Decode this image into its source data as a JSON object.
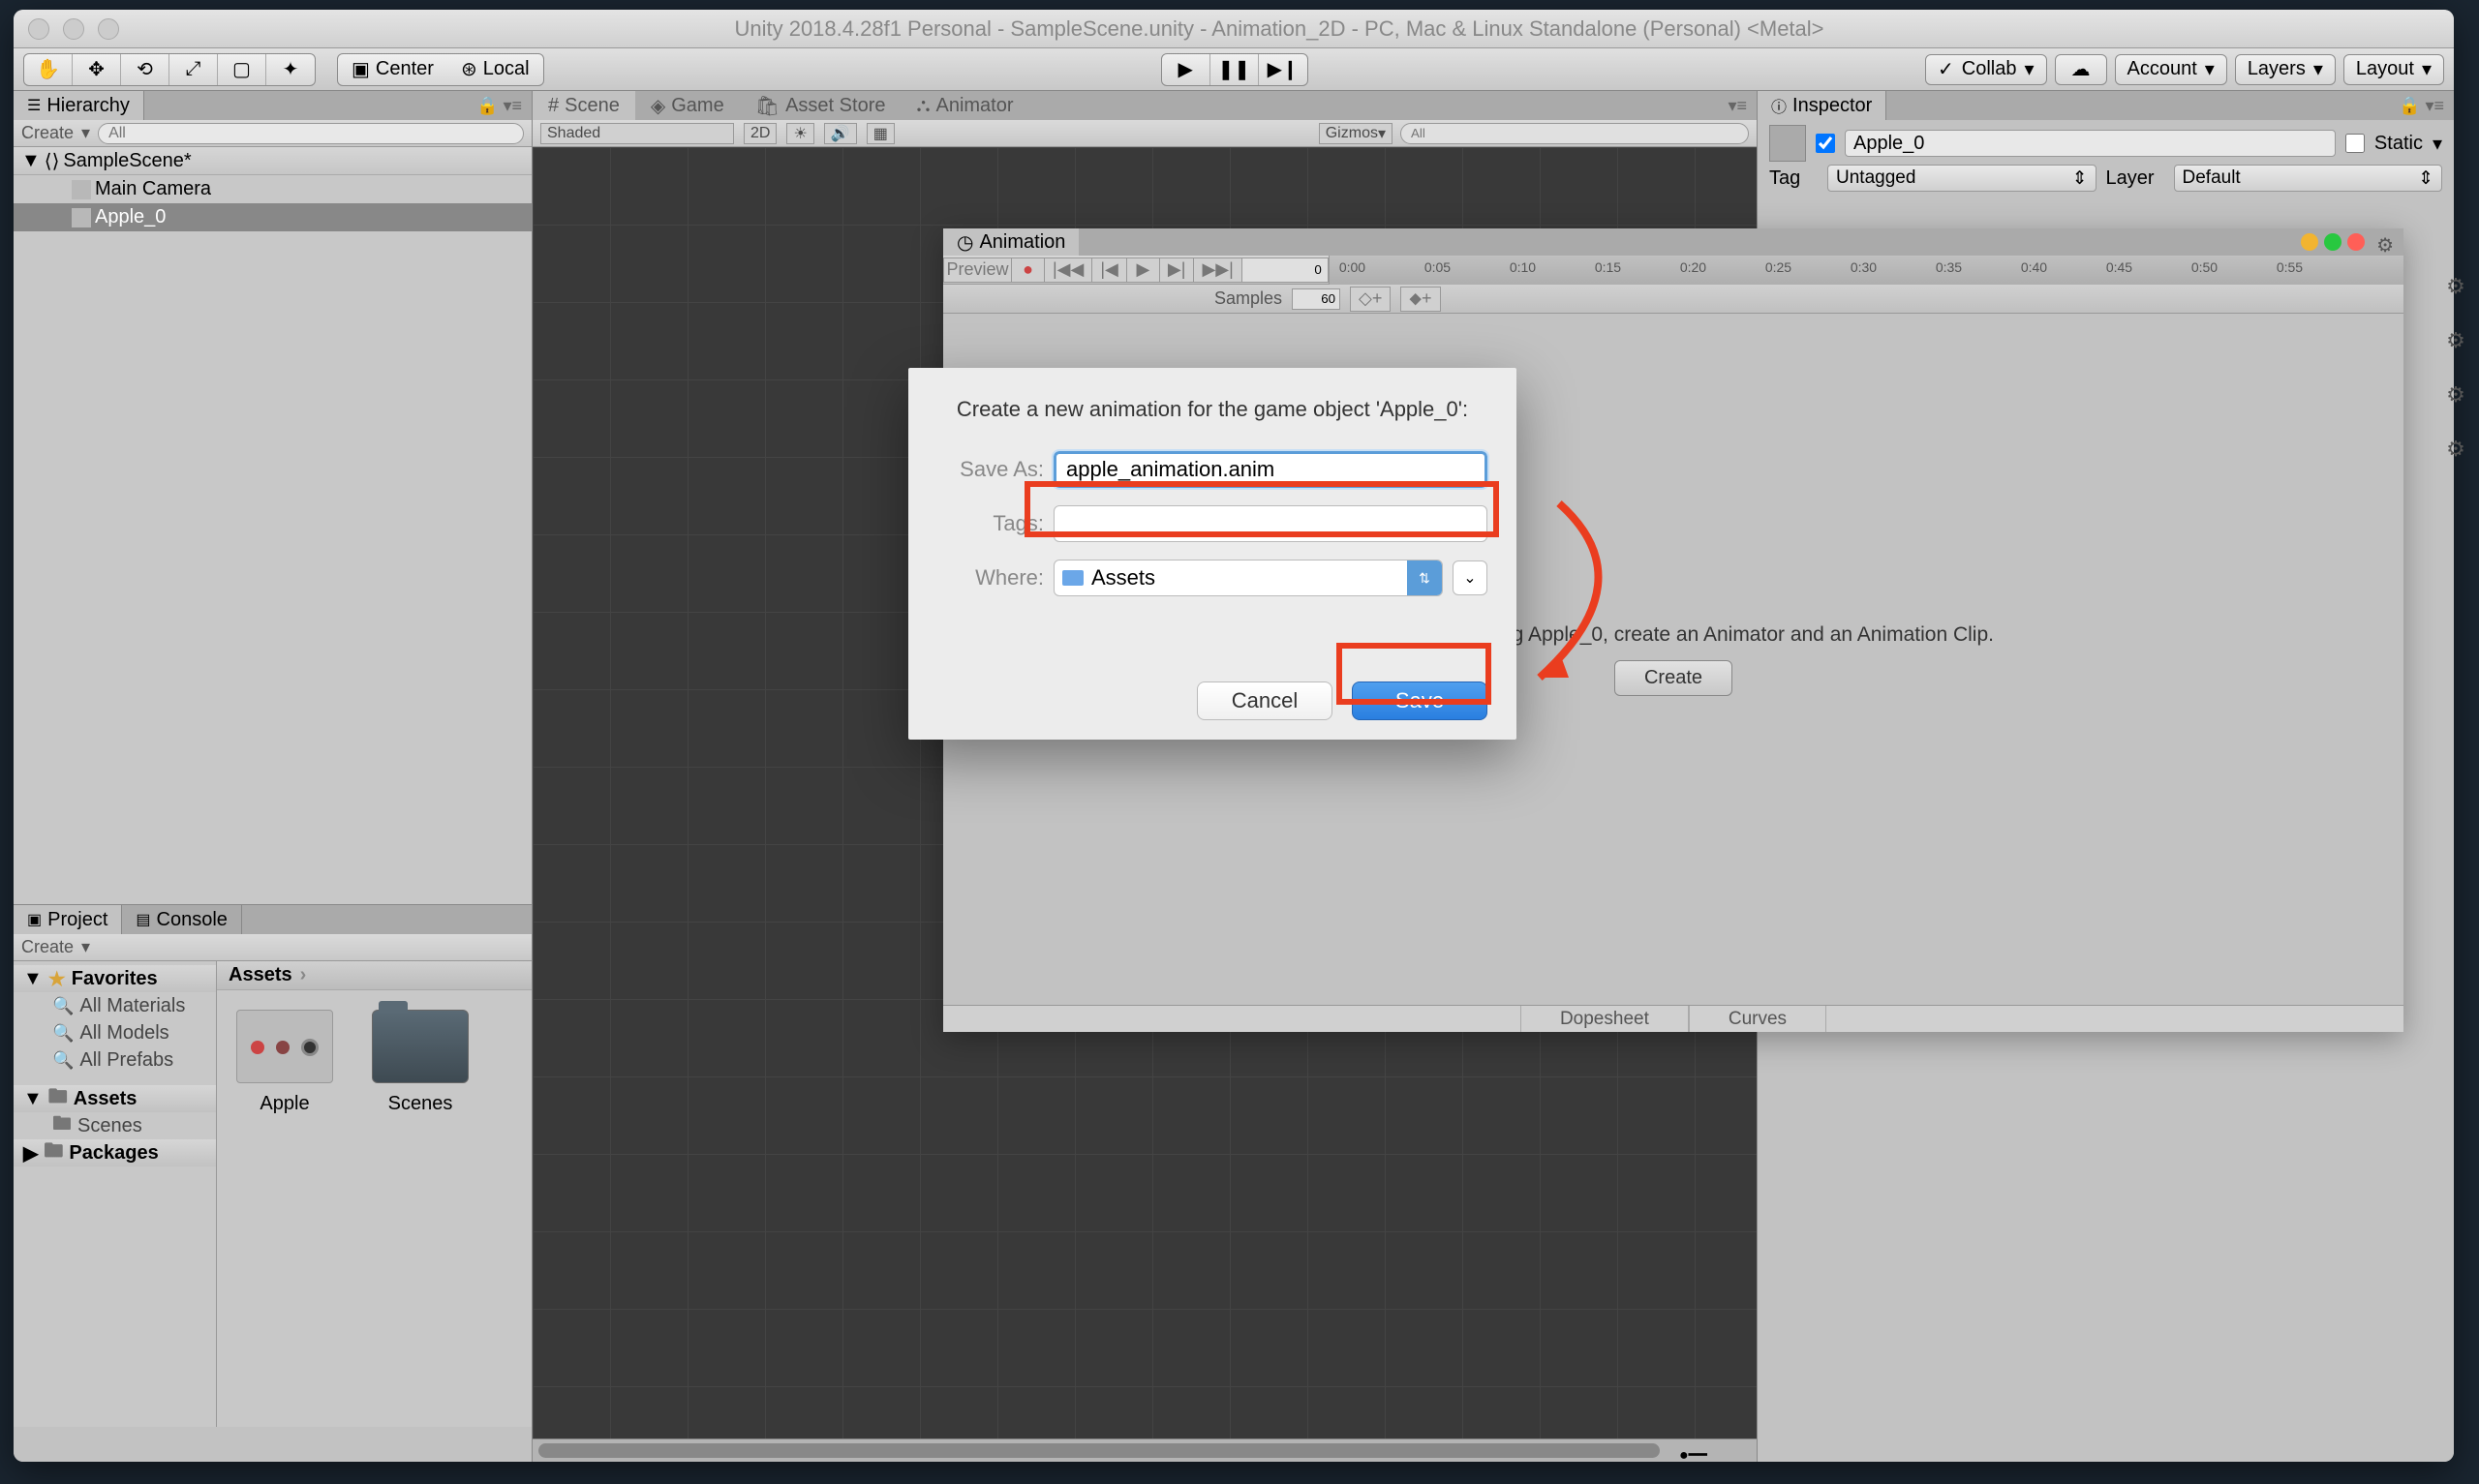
{
  "window": {
    "title": "Unity 2018.4.28f1 Personal - SampleScene.unity - Animation_2D - PC, Mac & Linux Standalone (Personal) <Metal>"
  },
  "toolbar": {
    "center_label": "Center",
    "local_label": "Local",
    "collab_label": "Collab",
    "account_label": "Account",
    "layers_label": "Layers",
    "layout_label": "Layout"
  },
  "hierarchy": {
    "tab": "Hierarchy",
    "create": "Create",
    "search_placeholder": "All",
    "root": "SampleScene*",
    "items": [
      "Main Camera",
      "Apple_0"
    ]
  },
  "scene_tabs": {
    "scene": "Scene",
    "game": "Game",
    "asset_store": "Asset Store",
    "animator": "Animator"
  },
  "scene_toolbar": {
    "shading": "Shaded",
    "mode_2d": "2D",
    "gizmos": "Gizmos",
    "search_placeholder": "All"
  },
  "inspector": {
    "tab": "Inspector",
    "object_name": "Apple_0",
    "static_label": "Static",
    "tag_label": "Tag",
    "tag_value": "Untagged",
    "layer_label": "Layer",
    "layer_value": "Default"
  },
  "project": {
    "tab_project": "Project",
    "tab_console": "Console",
    "create": "Create",
    "favorites": "Favorites",
    "fav_items": [
      "All Materials",
      "All Models",
      "All Prefabs"
    ],
    "assets": "Assets",
    "assets_children": [
      "Scenes"
    ],
    "packages": "Packages",
    "breadcrumb": "Assets",
    "grid_items": [
      "Apple",
      "Scenes"
    ]
  },
  "animation": {
    "tab": "Animation",
    "preview": "Preview",
    "frame_value": "0",
    "samples_label": "Samples",
    "samples_value": "60",
    "ruler_marks": [
      "0:00",
      "0:05",
      "0:10",
      "0:15",
      "0:20",
      "0:25",
      "0:30",
      "0:35",
      "0:40",
      "0:45",
      "0:50",
      "0:55"
    ],
    "message": "To begin animating Apple_0, create an Animator and an Animation Clip.",
    "create_btn": "Create",
    "dopesheet": "Dopesheet",
    "curves": "Curves"
  },
  "dialog": {
    "message": "Create a new animation for the game object 'Apple_0':",
    "save_as_label": "Save As:",
    "save_as_value": "apple_animation.anim",
    "tags_label": "Tags:",
    "where_label": "Where:",
    "where_value": "Assets",
    "cancel": "Cancel",
    "save": "Save"
  }
}
